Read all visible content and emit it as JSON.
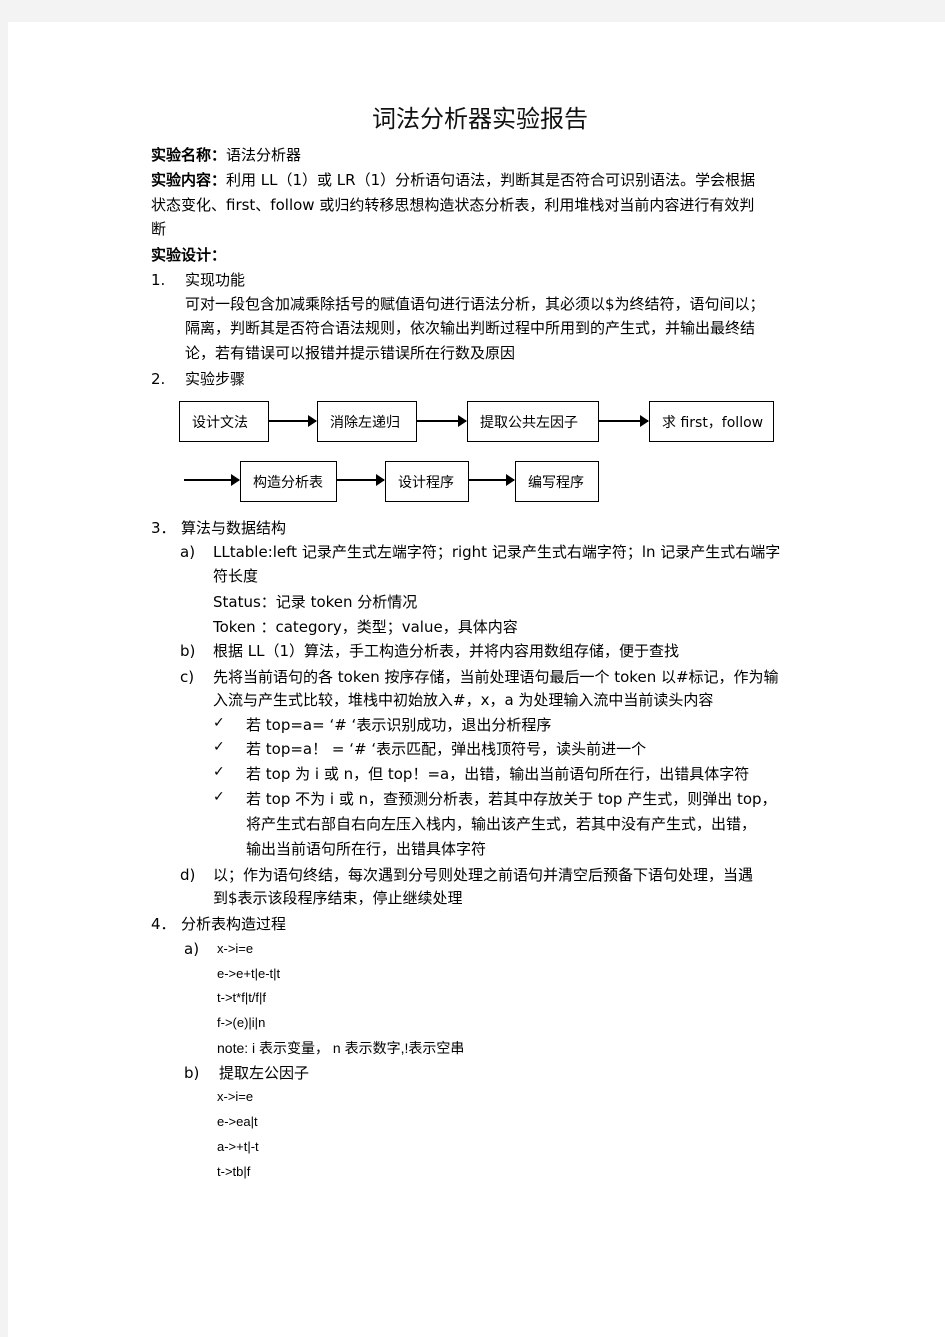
{
  "title": "词法分析器实验报告",
  "header": {
    "name_label": "实验名称：",
    "name_value": "语法分析器",
    "content_label": "实验内容：",
    "content_lines": [
      "利用 LL（1）或 LR（1）分析语句语法，判断其是否符合可识别语法。学会根据",
      "状态变化、first、follow 或归约转移思想构造状态分析表，利用堆栈对当前内容进行有效判",
      "断"
    ],
    "design_label": "实验设计："
  },
  "section1": {
    "number": "1.",
    "heading": "实现功能",
    "lines": [
      "可对一段包含加减乘除括号的赋值语句进行语法分析，其必须以$为终结符，语句间以；",
      "隔离，判断其是否符合语法规则，依次输出判断过程中所用到的产生式，并输出最终结",
      "论，若有错误可以报错并提示错误所在行数及原因"
    ]
  },
  "section2": {
    "number": "2.",
    "heading": "实验步骤",
    "flow_steps": [
      "设计文法",
      "消除左递归",
      "提取公共左因子",
      "求 first，follow",
      "构造分析表",
      "设计程序",
      "编写程序"
    ]
  },
  "section3": {
    "number": "3．",
    "heading": "算法与数据结构",
    "a": {
      "marker": "a)",
      "lines": [
        "LLtable:left 记录产生式左端字符；right 记录产生式右端字符；ln 记录产生式右端字",
        "符长度"
      ],
      "status": "Status：记录 token 分析情况",
      "token": "Token ：category，类型；value，具体内容"
    },
    "b": {
      "marker": "b)",
      "text": "根据 LL（1）算法，手工构造分析表，并将内容用数组存储，便于查找"
    },
    "c": {
      "marker": "c)",
      "lines": [
        "先将当前语句的各 token 按序存储，当前处理语句最后一个 token 以#标记，作为输",
        "入流与产生式比较，堆栈中初始放入#，x，a 为处理输入流中当前读头内容"
      ],
      "checks": [
        [
          "若 top=a= ‘# ‘表示识别成功，退出分析程序"
        ],
        [
          "若 top=a！ = ‘# ‘表示匹配，弹出栈顶符号，读头前进一个"
        ],
        [
          "若 top 为 i 或 n，但 top！=a，出错，输出当前语句所在行，出错具体字符"
        ],
        [
          "若 top 不为 i 或 n，查预测分析表，若其中存放关于 top 产生式，则弹出 top，",
          "将产生式右部自右向左压入栈内，输出该产生式，若其中没有产生式，出错，",
          "输出当前语句所在行，出错具体字符"
        ]
      ]
    },
    "d": {
      "marker": "d)",
      "lines": [
        "以；作为语句终结，每次遇到分号则处理之前语句并清空后预备下语句处理，当遇",
        "到$表示该段程序结束，停止继续处理"
      ]
    }
  },
  "section4": {
    "number": "4．",
    "heading": "分析表构造过程",
    "a": {
      "marker": "a)",
      "lines": [
        "x->i=e",
        "e->e+t|e-t|t",
        "t->t*f|t/f|f",
        "f->(e)|i|n",
        "note:    i 表示变量， n 表示数字,!表示空串"
      ]
    },
    "b": {
      "marker": "b)",
      "heading": "提取左公因子",
      "lines": [
        "x->i=e",
        "e->ea|t",
        "a->+t|-t",
        "t->tb|f"
      ]
    }
  },
  "icons": {
    "check": "✓"
  }
}
